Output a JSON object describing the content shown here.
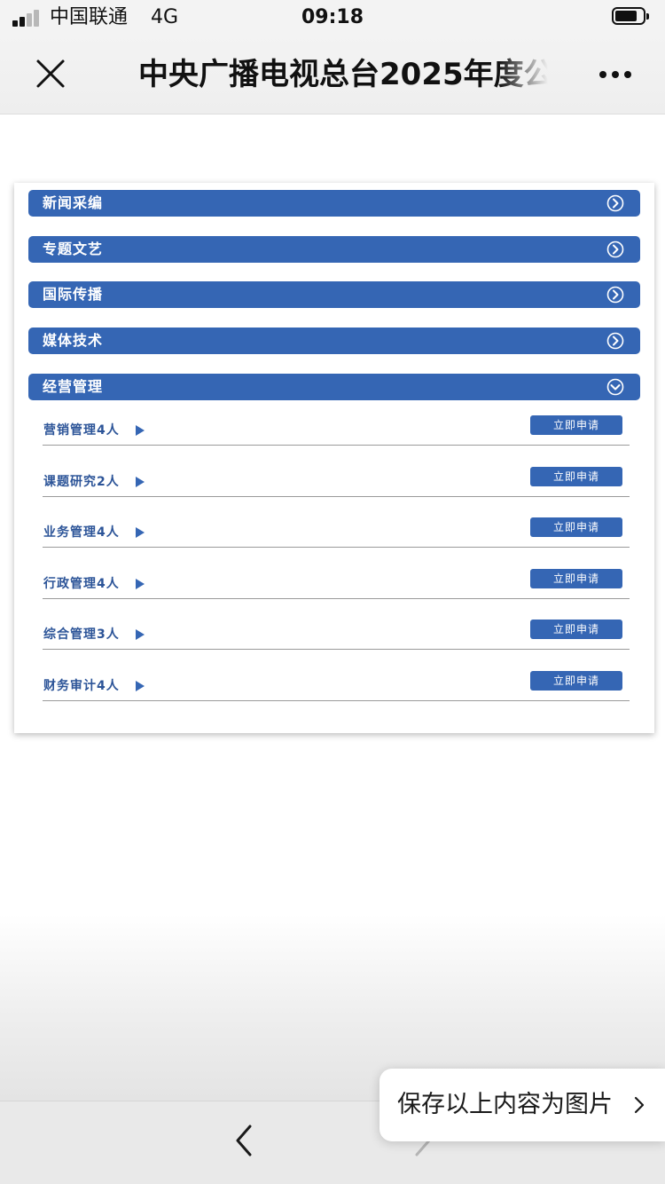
{
  "status_bar": {
    "carrier": "中国联通",
    "network": "4G",
    "time": "09:18"
  },
  "nav": {
    "title": "中央广播电视总台2025年度公",
    "close_icon": "close-icon",
    "more_icon": "more-icon"
  },
  "categories": [
    {
      "label": "新闻采编",
      "state": "collapsed",
      "icon": "circle-arrow-right-icon"
    },
    {
      "label": "专题文艺",
      "state": "collapsed",
      "icon": "circle-arrow-right-icon"
    },
    {
      "label": "国际传播",
      "state": "collapsed",
      "icon": "circle-arrow-right-icon"
    },
    {
      "label": "媒体技术",
      "state": "collapsed",
      "icon": "circle-arrow-right-icon"
    },
    {
      "label": "经营管理",
      "state": "expanded",
      "icon": "circle-arrow-down-icon"
    }
  ],
  "jobs": [
    {
      "label": "营销管理4人",
      "button": "立即申请"
    },
    {
      "label": "课题研究2人",
      "button": "立即申请"
    },
    {
      "label": "业务管理4人",
      "button": "立即申请"
    },
    {
      "label": "行政管理4人",
      "button": "立即申请"
    },
    {
      "label": "综合管理3人",
      "button": "立即申请"
    },
    {
      "label": "财务审计4人",
      "button": "立即申请"
    }
  ],
  "save_toast": {
    "label": "保存以上内容为图片",
    "icon": "chevron-right-icon"
  },
  "toolbar": {
    "back_icon": "back-icon",
    "forward_icon": "forward-icon"
  },
  "colors": {
    "accent": "#3566b4",
    "job_text": "#2c5498",
    "divider": "#9a9a9a"
  }
}
